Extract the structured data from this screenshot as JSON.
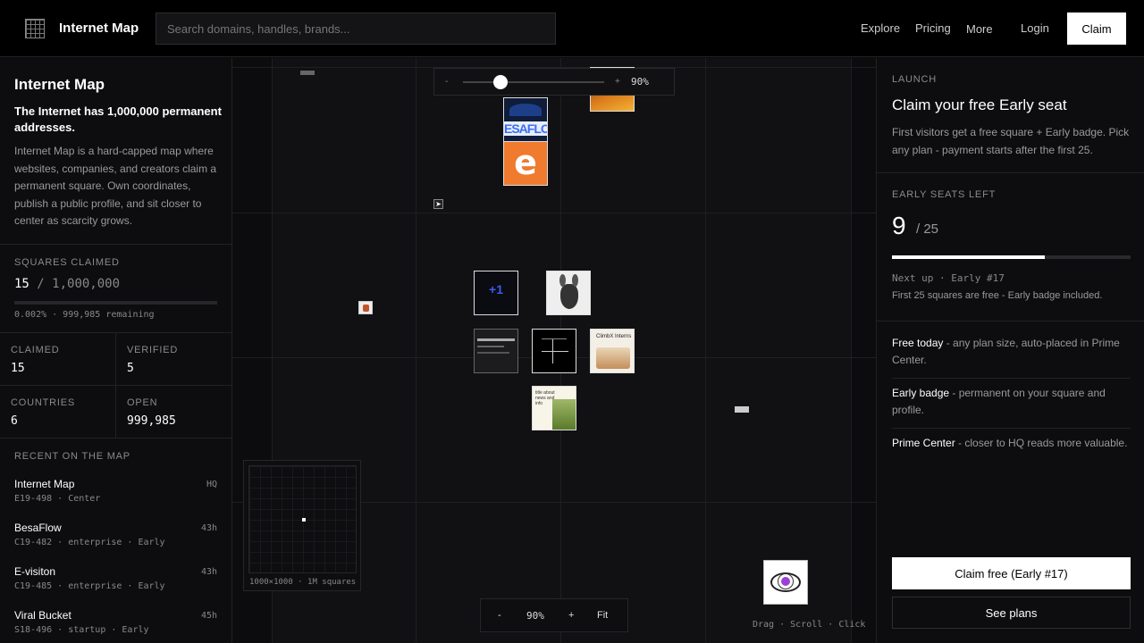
{
  "header": {
    "brand": "Internet Map",
    "search_placeholder": "Search domains, handles, brands...",
    "nav": [
      "Explore",
      "Pricing",
      "More"
    ],
    "login": "Login",
    "claim": "Claim"
  },
  "sidebar": {
    "title": "Internet Map",
    "lead": "The Internet has 1,000,000 permanent addresses.",
    "description": "Internet Map is a hard-capped map where websites, companies, and creators claim a permanent square. Own coordinates, publish a public profile, and sit closer to center as scarcity grows.",
    "squares_label": "SQUARES CLAIMED",
    "squares_claimed": "15",
    "squares_total": "/ 1,000,000",
    "claimed_fraction": 1.5e-05,
    "squares_sub": "0.002% · 999,985 remaining",
    "stats": [
      {
        "label": "CLAIMED",
        "value": "15"
      },
      {
        "label": "VERIFIED",
        "value": "5"
      },
      {
        "label": "COUNTRIES",
        "value": "6"
      },
      {
        "label": "OPEN",
        "value": "999,985"
      }
    ],
    "recent_title": "RECENT ON THE MAP",
    "recent": [
      {
        "name": "Internet Map",
        "meta": "E19-498 · Center",
        "age": "HQ"
      },
      {
        "name": "BesaFlow",
        "meta": "C19-482 · enterprise · Early",
        "age": "43h"
      },
      {
        "name": "E-visiton",
        "meta": "C19-485 · enterprise · Early",
        "age": "43h"
      },
      {
        "name": "Viral Bucket",
        "meta": "S18-496 · startup · Early",
        "age": "45h"
      }
    ]
  },
  "map": {
    "zoom_minus": "-",
    "zoom_plus": "+",
    "zoom_value": "90%",
    "zoom_level": 0.9,
    "tile_besaflow_text": "ESAFLO",
    "tile_evisiton_text": "e",
    "tile_plus1_text": "+1",
    "tile_climb_text": "ClimbX Interns",
    "tile_article_text": "title about news and info",
    "minimap_caption": "1000×1000 · 1M squares",
    "fit_label": "Fit",
    "hint": "Drag · Scroll · Click"
  },
  "panel": {
    "kicker": "LAUNCH",
    "title": "Claim your free Early seat",
    "intro": "First visitors get a free square + Early badge. Pick any plan - payment starts after the first 25.",
    "seats_label": "EARLY SEATS LEFT",
    "seats_left": "9",
    "seats_total": "/ 25",
    "seats_fraction": 0.64,
    "next_up": "Next up · Early #17",
    "free_note": "First 25 squares are free - Early badge included.",
    "benefits": [
      {
        "title": "Free today",
        "text": " - any plan size, auto-placed in Prime Center."
      },
      {
        "title": "Early badge",
        "text": " - permanent on your square and profile."
      },
      {
        "title": "Prime Center",
        "text": " - closer to HQ reads more valuable."
      }
    ],
    "cta_primary": "Claim free (Early #17)",
    "cta_secondary": "See plans"
  },
  "colors": {
    "background": "#0a0a0b",
    "map_bg": "#111114",
    "evisiton_orange": "#f07a2e",
    "besaflow_blue": "#2a5bd7",
    "plus1_blue": "#3a5df0",
    "eye_purple": "#9b3fd6"
  }
}
